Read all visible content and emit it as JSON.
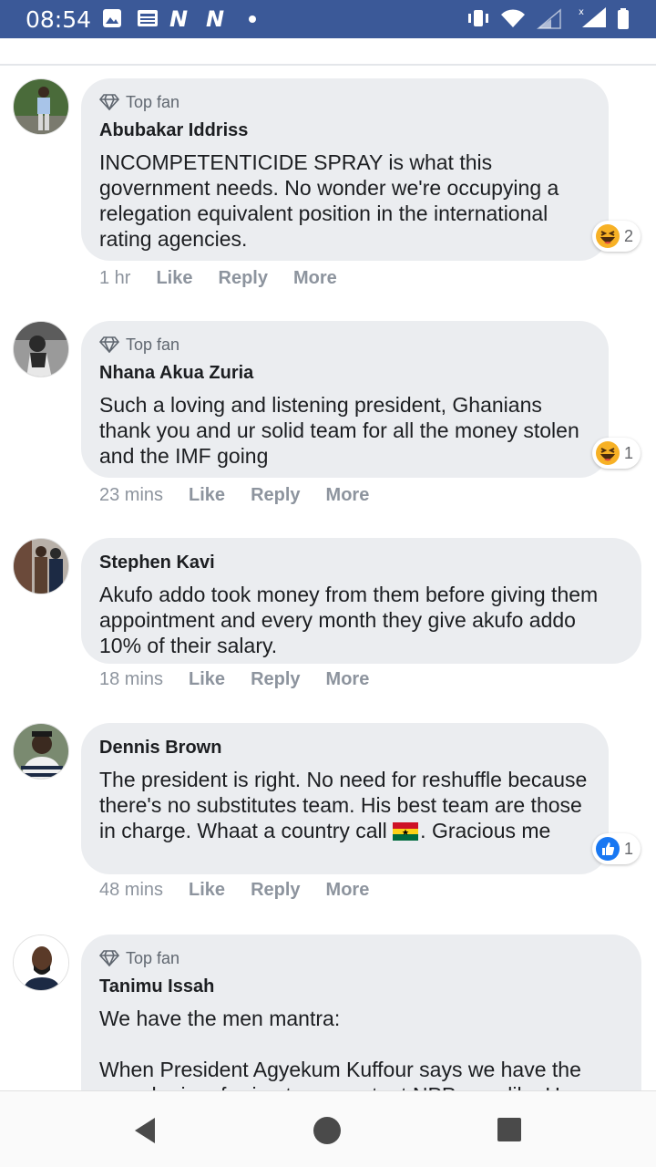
{
  "status_bar": {
    "time": "08:54"
  },
  "badge_label": "Top fan",
  "comments": [
    {
      "author": "Abubakar Iddriss",
      "top_fan": true,
      "text": "INCOMPETENTICIDE SPRAY is what this government needs. No wonder we're occupying a relegation equivalent position in the international rating agencies.",
      "time": "1 hr",
      "reaction": {
        "type": "haha",
        "count": "2"
      }
    },
    {
      "author": "Nhana Akua Zuria",
      "top_fan": true,
      "text": "Such a loving and listening president, Ghanians thank you and ur solid team for all the money stolen and the IMF going",
      "time": "23 mins",
      "reaction": {
        "type": "haha",
        "count": "1"
      }
    },
    {
      "author": "Stephen Kavi",
      "top_fan": false,
      "text": "Akufo addo took money from them before giving them appointment and every month they give akufo addo 10% of their salary.",
      "time": "18 mins"
    },
    {
      "author": "Dennis Brown",
      "top_fan": false,
      "text_before_flag": "The president is right. No need for reshuffle because there's no substitutes team. His best team are those in charge. Whaat a country call",
      "text_after_flag": ". Gracious me",
      "time": "48 mins",
      "reaction": {
        "type": "like",
        "count": "1"
      }
    },
    {
      "author": "Tanimu Issah",
      "top_fan": true,
      "text_line1": "We have the men mantra:",
      "text_line2": "When President Agyekum Kuffour says we have the",
      "text_line3": "men, he is referring to competent NPP men like Hon"
    }
  ],
  "actions": {
    "like": "Like",
    "reply": "Reply",
    "more": "More"
  },
  "colors": {
    "statusbar": "#3b5998",
    "bubble": "#ebedf0",
    "like_blue": "#1877f2",
    "haha_yellow": "#f7b125"
  }
}
